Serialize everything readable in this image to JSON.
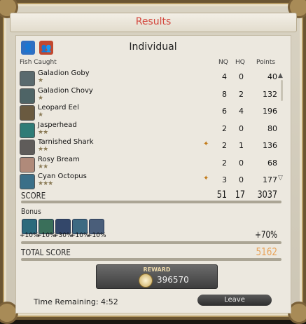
{
  "window": {
    "title": "Results"
  },
  "mode": {
    "heading": "Individual",
    "icons": [
      "party-member-icon",
      "party-icon"
    ]
  },
  "table": {
    "headers": {
      "fish": "Fish Caught",
      "nq": "NQ",
      "hq": "HQ",
      "points": "Points"
    },
    "rows": [
      {
        "name": "Galadion Goby",
        "stars": "★",
        "nq": "4",
        "hq": "0",
        "points": "40",
        "color": "#5a6a6e",
        "mark": ""
      },
      {
        "name": "Galadion Chovy",
        "stars": "★",
        "nq": "8",
        "hq": "2",
        "points": "132",
        "color": "#4e6466",
        "mark": ""
      },
      {
        "name": "Leopard Eel",
        "stars": "★",
        "nq": "6",
        "hq": "4",
        "points": "196",
        "color": "#6a5a40",
        "mark": ""
      },
      {
        "name": "Jasperhead",
        "stars": "★★",
        "nq": "2",
        "hq": "0",
        "points": "80",
        "color": "#2f7c77",
        "mark": ""
      },
      {
        "name": "Tarnished Shark",
        "stars": "★★",
        "nq": "2",
        "hq": "1",
        "points": "136",
        "color": "#5f5c5a",
        "mark": "✦"
      },
      {
        "name": "Rosy Bream",
        "stars": "★★",
        "nq": "2",
        "hq": "0",
        "points": "68",
        "color": "#b08a7a",
        "mark": ""
      },
      {
        "name": "Cyan Octopus",
        "stars": "★★★",
        "nq": "3",
        "hq": "0",
        "points": "177",
        "color": "#3b6f88",
        "mark": "✦"
      }
    ]
  },
  "score": {
    "label": "SCORE",
    "nq": "51",
    "hq": "17",
    "points": "3037"
  },
  "bonus": {
    "label": "Bonus",
    "items": [
      {
        "pct": "+10%",
        "color": "#2c6a7c"
      },
      {
        "pct": "+10%",
        "color": "#3a6f5a"
      },
      {
        "pct": "+30%",
        "color": "#33476a"
      },
      {
        "pct": "+10%",
        "color": "#3d6a82"
      },
      {
        "pct": "+10%",
        "color": "#4a5e7a"
      }
    ],
    "total": "+70%"
  },
  "total_score": {
    "label": "TOTAL SCORE",
    "value": "5162",
    "color": "#e8a35a"
  },
  "reward": {
    "label": "REWARD",
    "value": "396570"
  },
  "footer": {
    "time": "Time Remaining: 4:52",
    "leave": "Leave"
  },
  "colors": {
    "title": "#d3473d",
    "frame": "#6b5532"
  }
}
